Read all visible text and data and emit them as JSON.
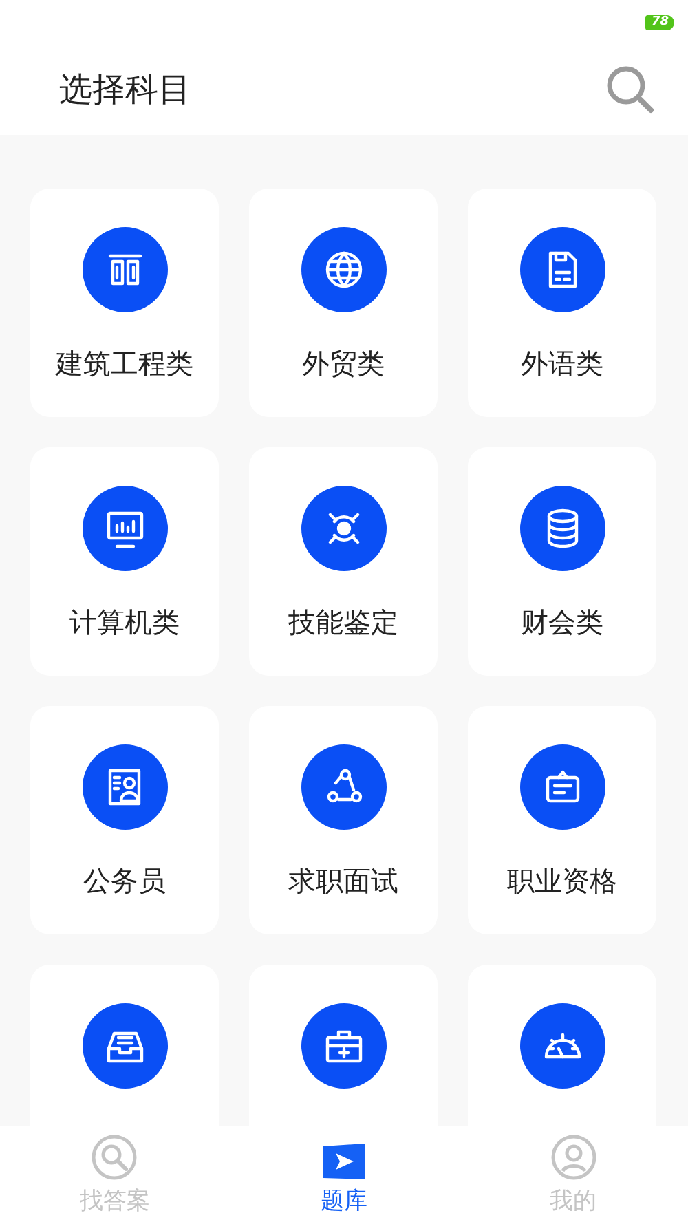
{
  "status_bar": {
    "battery": "78"
  },
  "header": {
    "title": "选择科目"
  },
  "categories": [
    {
      "kind": "labelled",
      "label": "建筑工程类"
    },
    {
      "kind": "labelled",
      "label": "外贸类"
    },
    {
      "kind": "labelled",
      "label": "外语类"
    },
    {
      "kind": "labelled",
      "label": "计算机类"
    },
    {
      "kind": "labelled",
      "label": "技能鉴定"
    },
    {
      "kind": "labelled",
      "label": "财会类"
    },
    {
      "kind": "labelled",
      "label": "公务员"
    },
    {
      "kind": "labelled",
      "label": "求职面试"
    },
    {
      "kind": "labelled",
      "label": "职业资格"
    },
    {
      "kind": "cut_off"
    },
    {
      "kind": "cut_off"
    },
    {
      "kind": "cut_off"
    }
  ],
  "tab_bar": [
    {
      "label": "找答案",
      "selected": false
    },
    {
      "label": "题库",
      "selected": true
    },
    {
      "label": "我的",
      "selected": false
    }
  ]
}
